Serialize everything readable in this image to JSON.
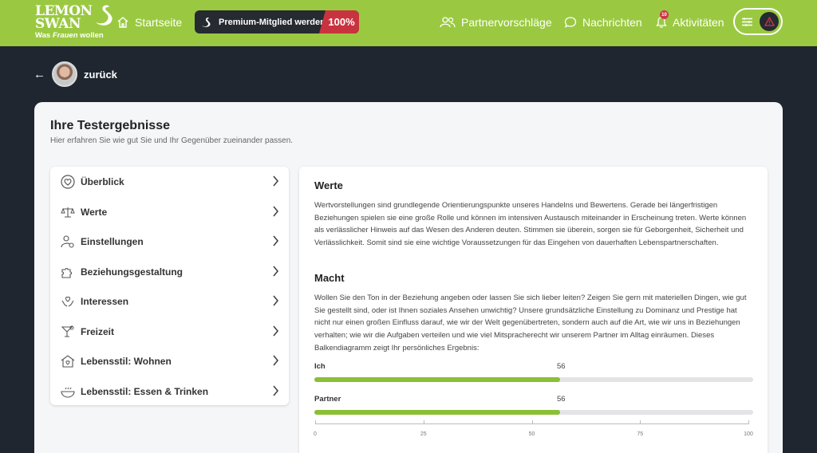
{
  "brand": {
    "name_line1": "LEMON",
    "name_line2": "SWAN",
    "tagline_prefix": "Was ",
    "tagline_em": "Frauen",
    "tagline_suffix": " wollen"
  },
  "nav": {
    "home": "Startseite",
    "premium": "Premium-Mitglied werden",
    "premium_pct": "100%",
    "partner": "Partnervorschläge",
    "messages": "Nachrichten",
    "activities": "Aktivitäten",
    "activities_badge": "10"
  },
  "back": {
    "label": "zurück"
  },
  "page": {
    "title": "Ihre Testergebnisse",
    "subtitle": "Hier erfahren Sie wie gut Sie und Ihr Gegenüber zueinander passen."
  },
  "sidebar": {
    "items": [
      {
        "label": "Überblick",
        "icon": "heart-circle-icon"
      },
      {
        "label": "Werte",
        "icon": "scales-icon"
      },
      {
        "label": "Einstellungen",
        "icon": "person-gear-icon"
      },
      {
        "label": "Beziehungsgestaltung",
        "icon": "puzzle-icon"
      },
      {
        "label": "Interessen",
        "icon": "hands-heart-icon"
      },
      {
        "label": "Freizeit",
        "icon": "cocktail-icon"
      },
      {
        "label": "Lebensstil: Wohnen",
        "icon": "house-heart-icon"
      },
      {
        "label": "Lebensstil: Essen & Trinken",
        "icon": "bowl-icon"
      }
    ]
  },
  "content": {
    "werte_title": "Werte",
    "werte_text": "Wertvorstellungen sind grundlegende Orientierungspunkte unseres Handelns und Bewertens. Gerade bei längerfristigen Beziehungen spielen sie eine große Rolle und können im intensiven Austausch miteinander in Erscheinung treten. Werte können als verlässlicher Hinweis auf das Wesen des Anderen deuten. Stimmen sie überein, sorgen sie für Geborgenheit, Sicherheit und Verlässlichkeit. Somit sind sie eine wichtige Voraussetzungen für das Eingehen von dauerhaften Lebenspartnerschaften.",
    "macht_title": "Macht",
    "macht_text": "Wollen Sie den Ton in der Beziehung angeben oder lassen Sie sich lieber leiten? Zeigen Sie gern mit materiellen Dingen, wie gut Sie gestellt sind, oder ist Ihnen soziales Ansehen unwichtig? Unsere grundsätzliche Einstellung zu Dominanz und Prestige hat nicht nur einen großen Einfluss darauf, wie wir der Welt gegenübertreten, sondern auch auf die Art, wie wir uns in Beziehungen verhalten; wie wir die Aufgaben verteilen und wie viel Mitspracherecht wir unserem Partner im Alltag einräumen. Dieses Balkendiagramm zeigt Ihr persönliches Ergebnis:"
  },
  "colors": {
    "brand_green": "#9ac941",
    "bar_green": "#8bbf36",
    "premium_red": "#c8333f",
    "dark": "#262a31"
  },
  "chart_data": {
    "type": "bar",
    "orientation": "horizontal",
    "categories": [
      "Ich",
      "Partner"
    ],
    "values": [
      56,
      56
    ],
    "xlim": [
      0,
      100
    ],
    "ticks": [
      "0",
      "25",
      "50",
      "75",
      "100"
    ],
    "value_labels": [
      "56",
      "56"
    ]
  }
}
